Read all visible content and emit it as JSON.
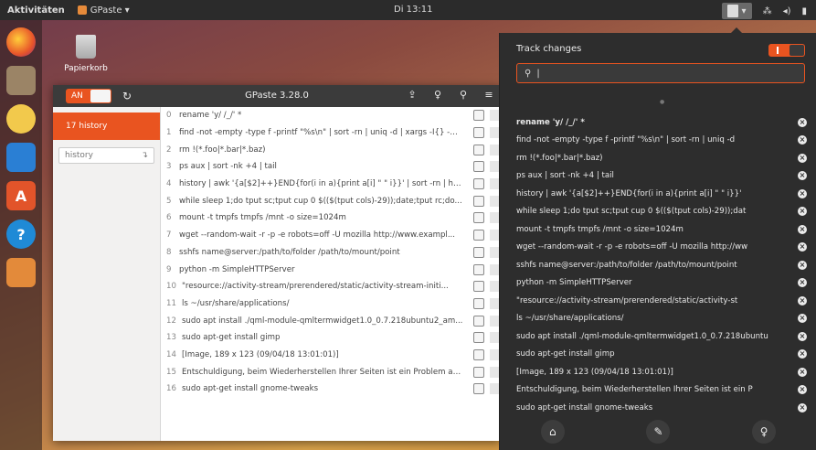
{
  "topbar": {
    "activities": "Aktivitäten",
    "app_menu": "GPaste ▾",
    "clock": "Di 13:11",
    "tray_menu": "▾",
    "tray_network": "⁂",
    "tray_sound": "◂)",
    "tray_battery": "▮"
  },
  "desktop": {
    "trash_label": "Papierkorb"
  },
  "gpaste_window": {
    "toggle_label": "AN",
    "title": "GPaste 3.28.0",
    "sidebar": {
      "history_item": "17  history",
      "history_input_value": "history",
      "history_input_icon": "↴"
    },
    "rows": [
      {
        "idx": "0",
        "text": "rename 'y/ /_/' *"
      },
      {
        "idx": "1",
        "text": "find -not -empty -type f -printf \"%s\\n\" | sort -rn | uniq -d | xargs -I{} -n1 fi..."
      },
      {
        "idx": "2",
        "text": "rm !(*.foo|*.bar|*.baz)"
      },
      {
        "idx": "3",
        "text": "ps aux | sort -nk +4 | tail"
      },
      {
        "idx": "4",
        "text": "history | awk '{a[$2]++}END{for(i in a){print a[i] \" \" i}}' | sort -rn | head"
      },
      {
        "idx": "5",
        "text": "while sleep 1;do tput sc;tput cup 0 $(($(tput cols)-29));date;tput rc;do..."
      },
      {
        "idx": "6",
        "text": "mount -t tmpfs tmpfs /mnt -o size=1024m"
      },
      {
        "idx": "7",
        "text": "wget --random-wait -r -p -e robots=off -U mozilla http://www.exampl..."
      },
      {
        "idx": "8",
        "text": "sshfs name@server:/path/to/folder /path/to/mount/point"
      },
      {
        "idx": "9",
        "text": "python -m SimpleHTTPServer"
      },
      {
        "idx": "10",
        "text": "\"resource://activity-stream/prerendered/static/activity-stream-initi..."
      },
      {
        "idx": "11",
        "text": "ls ~/usr/share/applications/"
      },
      {
        "idx": "12",
        "text": "sudo apt install ./qml-module-qmltermwidget1.0_0.7.218ubuntu2_am..."
      },
      {
        "idx": "13",
        "text": "sudo apt-get install gimp"
      },
      {
        "idx": "14",
        "text": "[Image, 189 x 123 (09/04/18 13:01:01)]"
      },
      {
        "idx": "15",
        "text": "Entschuldigung, beim Wiederherstellen Ihrer Seiten ist ein Problem au..."
      },
      {
        "idx": "16",
        "text": "sudo apt-get install gnome-tweaks"
      }
    ]
  },
  "panel": {
    "track_changes": "Track changes",
    "search_value": "|",
    "items": [
      "rename 'y/ /_/' *",
      "find -not -empty -type f -printf \"%s\\n\" | sort -rn | uniq -d",
      "rm !(*.foo|*.bar|*.baz)",
      "ps aux | sort -nk +4 | tail",
      "history | awk '{a[$2]++}END{for(i in a){print a[i] \" \" i}}'",
      "while sleep 1;do tput sc;tput cup 0 $(($(tput cols)-29));dat",
      "mount -t tmpfs tmpfs /mnt -o size=1024m",
      "wget --random-wait -r -p -e robots=off -U mozilla http://ww",
      "sshfs name@server:/path/to/folder /path/to/mount/point",
      "python -m SimpleHTTPServer",
      "\"resource://activity-stream/prerendered/static/activity-st",
      "ls ~/usr/share/applications/",
      "sudo apt install ./qml-module-qmltermwidget1.0_0.7.218ubuntu",
      "sudo apt-get install gimp",
      "[Image, 189 x 123 (09/04/18 13:01:01)]",
      "Entschuldigung, beim Wiederherstellen Ihrer Seiten ist ein P",
      "sudo apt-get install gnome-tweaks"
    ],
    "footer": {
      "home_icon": "⌂",
      "brush_icon": "✎",
      "bulb_icon": "♀"
    }
  },
  "colors": {
    "accent": "#e95420",
    "panel_bg": "#2d2d2d",
    "topbar_bg": "#2b2b2b"
  }
}
